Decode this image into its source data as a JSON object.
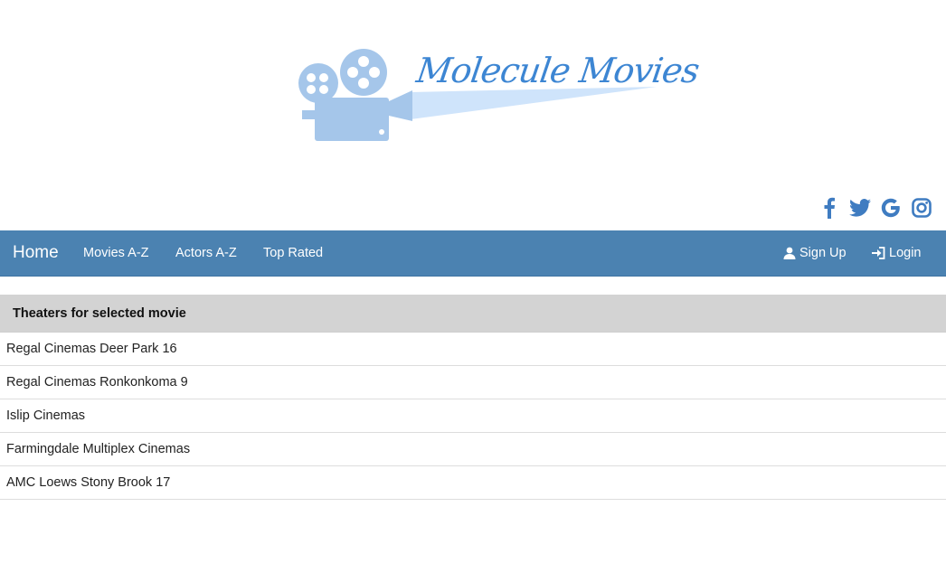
{
  "logo": {
    "text": "Molecule Movies",
    "colors": {
      "text": "#3d86d3",
      "camera": "#a5c6ea",
      "beam": "#cfe4fb"
    }
  },
  "social": {
    "icons": [
      "facebook-icon",
      "twitter-icon",
      "google-icon",
      "instagram-icon"
    ],
    "color": "#3f7cc1"
  },
  "navbar": {
    "background": "#4b82b1",
    "brand": "Home",
    "links": [
      "Movies A-Z",
      "Actors A-Z",
      "Top Rated"
    ],
    "signup": "Sign Up",
    "login": "Login",
    "signup_icon": "user-icon",
    "login_icon": "login-icon"
  },
  "panel": {
    "heading": "Theaters for selected movie",
    "theaters": [
      "Regal Cinemas Deer Park 16",
      "Regal Cinemas Ronkonkoma 9",
      "Islip Cinemas",
      "Farmingdale Multiplex Cinemas",
      "AMC Loews Stony Brook 17"
    ]
  }
}
